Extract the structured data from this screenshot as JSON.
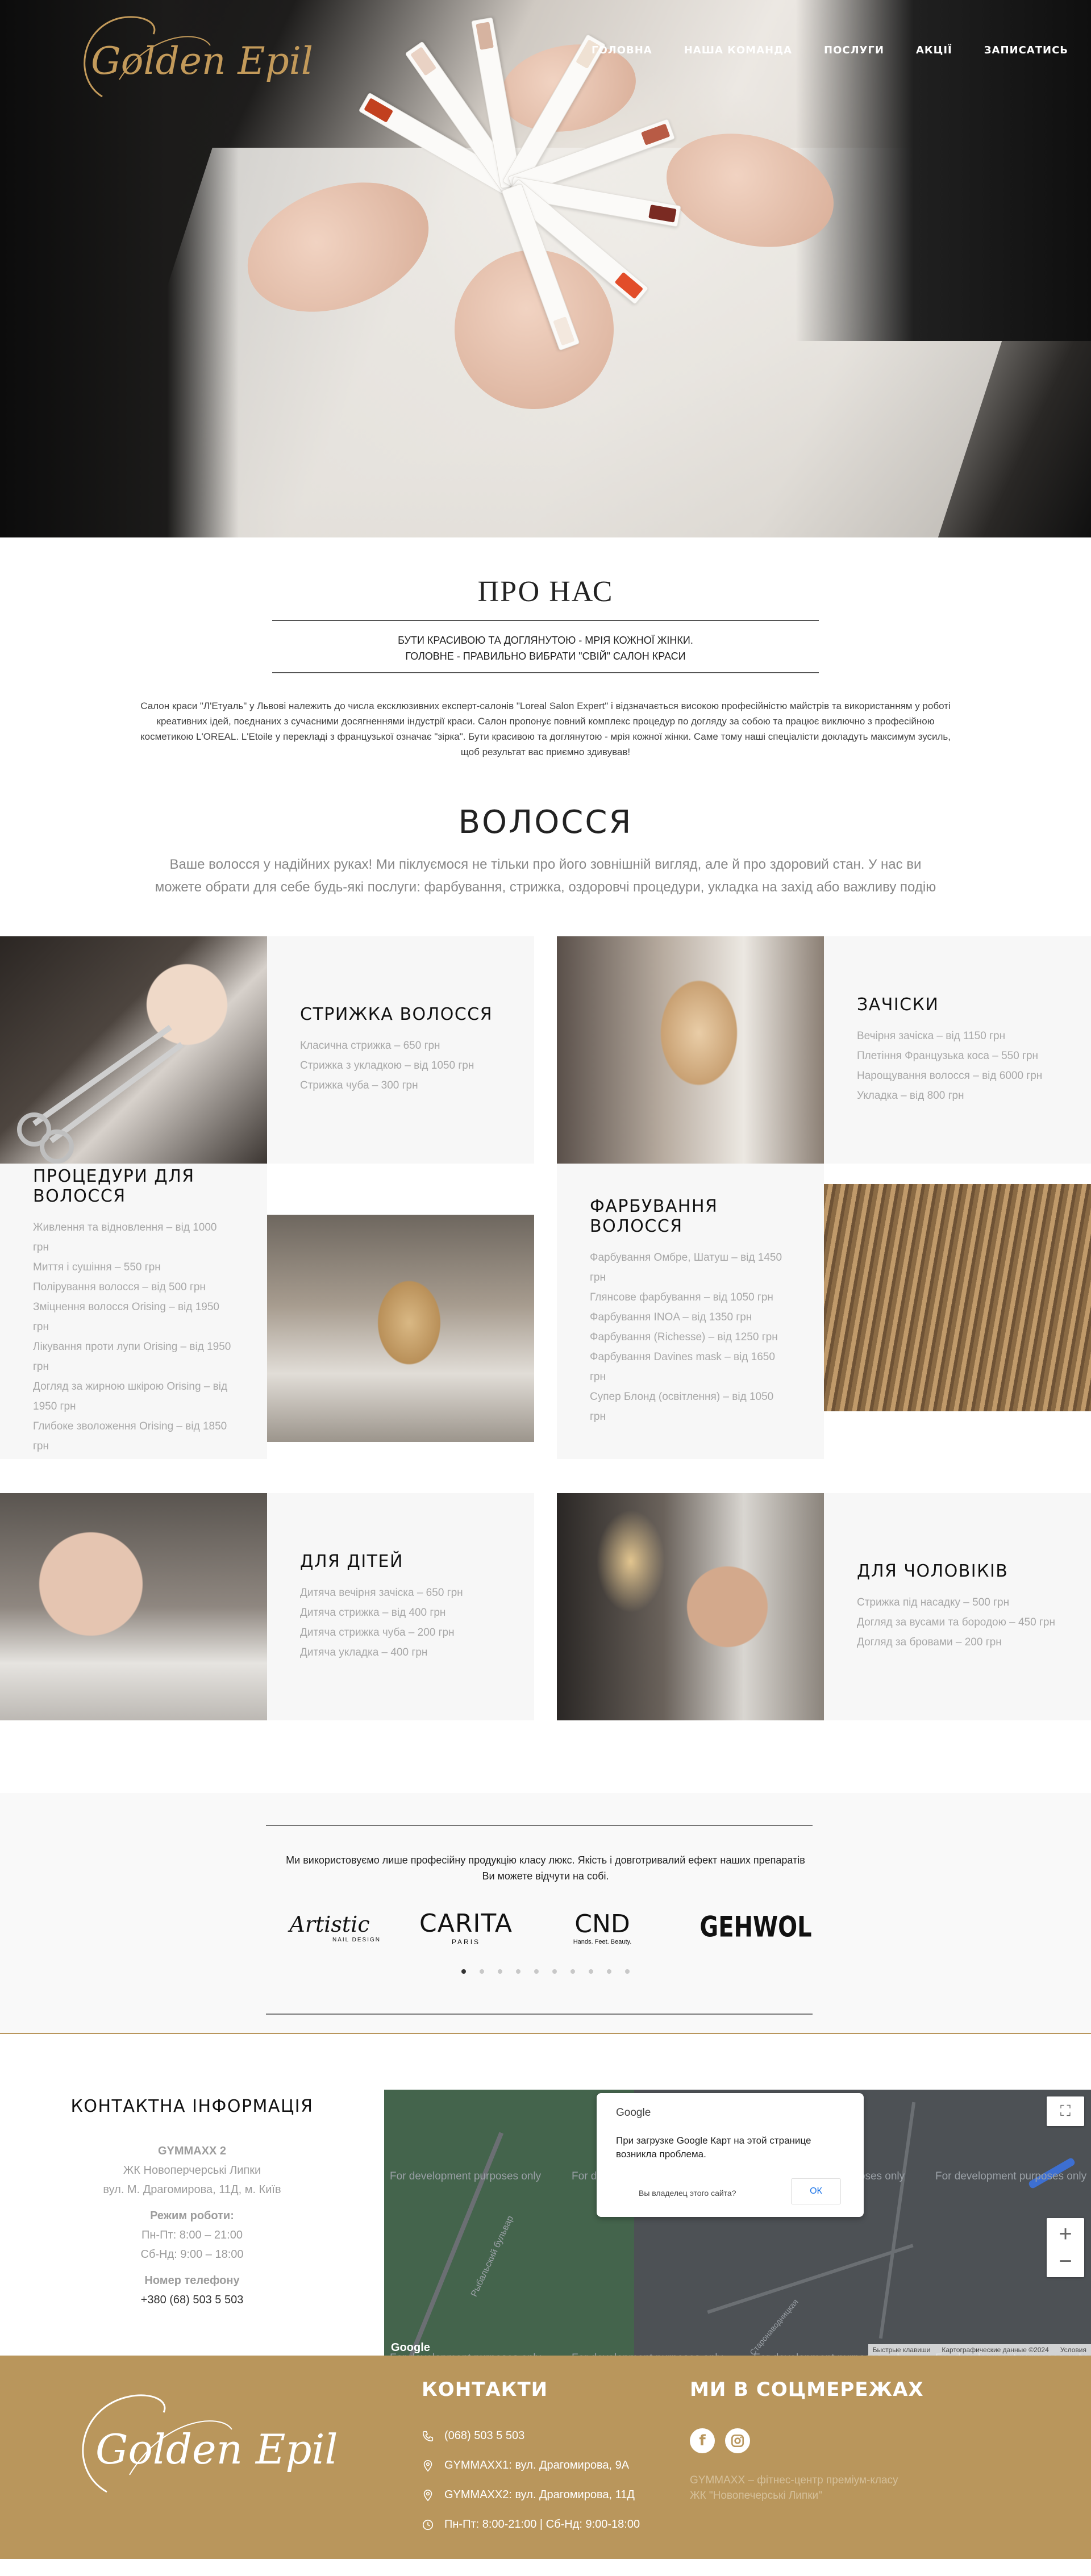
{
  "brand": {
    "logo_text": "Golden Epil",
    "accent": "#b9965c"
  },
  "nav": {
    "items": [
      {
        "label": "ГОЛОВНА"
      },
      {
        "label": "НАША КОМАНДА"
      },
      {
        "label": "ПОСЛУГИ"
      },
      {
        "label": "АКЦІЇ"
      },
      {
        "label": "ЗАПИСАТИСЬ"
      }
    ]
  },
  "about": {
    "title": "ПРО НАС",
    "slogan_1": "БУТИ КРАСИВОЮ ТА ДОГЛЯНУТОЮ - МРІЯ КОЖНОЇ ЖІНКИ.",
    "slogan_2": "ГОЛОВНЕ - ПРАВИЛЬНО ВИБРАТИ \"СВІЙ\" САЛОН КРАСИ",
    "text": "Салон краси \"Л'Етуаль\" у Львові належить до числа ексклюзивних експерт-салонів \"Loreal Salon Expert\" і відзначається високою професійністю майстрів та використанням у роботі креативних ідей, поєднаних з сучасними досягненнями індустрії краси. Салон пропонує повний комплекс процедур по догляду за собою та працює виключно з професійною косметикою L'OREAL. L'Etoile у перекладі з французької означає \"зірка\". Бути красивою та доглянутою - мрія кожної жінки. Саме тому наші спеціалісти докладуть максимум зусиль, щоб результат вас приємно здивував!"
  },
  "hair": {
    "title": "ВОЛОССЯ",
    "subtitle": "Ваше волосся у надійних руках! Ми піклуємося не тільки про його зовнішній вигляд, але й про здоровий стан. У нас ви можете обрати для себе будь-які послуги: фарбування, стрижка, оздоровчі процедури, укладка на захід або важливу подію"
  },
  "services": [
    {
      "title": "СТРИЖКА ВОЛОССЯ",
      "items": [
        "Класична стрижка – 650 грн",
        "Стрижка з укладкою – від 1050 грн",
        "Стрижка чуба – 300 грн"
      ]
    },
    {
      "title": "ЗАЧІСКИ",
      "items": [
        "Вечірня зачіска – від 1150 грн",
        "Плетіння Французька коса – 550 грн",
        "Нарощування волосся – від 6000 грн",
        "Укладка – від 800 грн"
      ]
    },
    {
      "title": "ПРОЦЕДУРИ ДЛЯ ВОЛОССЯ",
      "items": [
        "Живлення та відновлення – від 1000 грн",
        "Миття і сушіння – 550 грн",
        "Полірування волосся – від 500 грн",
        "Зміцнення волосся Orising – від 1950 грн",
        "Лікування проти лупи Orising – від 1950 грн",
        "Догляд за жирною шкірою Orising – від 1950 грн",
        "Глибоке зволоження Orising – від 1850 грн"
      ]
    },
    {
      "title": "ФАРБУВАННЯ ВОЛОССЯ",
      "items": [
        "Фарбування Омбре, Шатуш – від 1450 грн",
        "Глянсове фарбування – від 1050 грн",
        "Фарбування INOA – від 1350 грн",
        "Фарбування (Richesse) – від 1250 грн",
        "Фарбування Davines mask – від 1650 грн",
        "Супер Блонд (освітлення) – від 1050 грн"
      ]
    },
    {
      "title": "ДЛЯ ДІТЕЙ",
      "items": [
        "Дитяча вечірня зачіска – 650 грн",
        "Дитяча стрижка – від 400 грн",
        "Дитяча стрижка чуба – 200 грн",
        "Дитяча укладка – 400 грн"
      ]
    },
    {
      "title": "ДЛЯ ЧОЛОВІКІВ",
      "items": [
        "Стрижка під насадку – 500 грн",
        "Догляд за вусами та бородою – 450 грн",
        "Догляд за бровами – 200 грн"
      ]
    }
  ],
  "brands": {
    "caption_1": "Ми використовуємо лише професійну продукцію класу люкс. Якість і довготривалий ефект наших препаратів",
    "caption_2": "Ви можете відчути на собі.",
    "logos": [
      {
        "name": "Artistic",
        "sub": "NAIL DESIGN"
      },
      {
        "name": "CARITA",
        "sub": "PARIS"
      },
      {
        "name": "CND",
        "sub": "Hands. Feet. Beauty."
      },
      {
        "name": "GEHWOL",
        "sub": ""
      }
    ],
    "dots": 10
  },
  "contact": {
    "title": "КОНТАКТНА ІНФОРМАЦІЯ",
    "name": "GYMMAXX 2",
    "complex": "ЖК Новоперчерські Липки",
    "address": "вул. М. Драгомирова, 11Д, м. Київ",
    "hours_label": "Режим роботи:",
    "hours_1": "Пн-Пт: 8:00 – 21:00",
    "hours_2": "Сб-Нд: 9:00 – 18:00",
    "phone_label": "Номер телефону",
    "phone": "+380 (68) 503 5 503"
  },
  "map": {
    "dev_text": "For development purposes only",
    "dialog_brand": "Google",
    "dialog_message": "При загрузке Google Карт на этой странице возникла проблема.",
    "dialog_question": "Вы владелец этого сайта?",
    "dialog_ok": "ОК",
    "street_1": "Рыбальский бульвар",
    "street_2": "Старонаводницкая",
    "attribution_1": "Быстрые клавиши",
    "attribution_2": "Картографические данные ©2024",
    "attribution_3": "Условия",
    "google_logo": "Google"
  },
  "footer": {
    "contacts_title": "КОНТАКТИ",
    "phone": "(068) 503 5 503",
    "address_1": "GYMMAXX1: вул. Драгомирова, 9А",
    "address_2": "GYMMAXX2: вул. Драгомирова, 11Д",
    "hours": "Пн-Пт: 8:00-21:00 | Сб-Нд: 9:00-18:00",
    "social_title": "МИ В СОЦМЕРЕЖАХ",
    "faint_1": "GYMMAXX – фітнес-центр преміум-класу",
    "faint_2": "ЖК \"Новопечерські Липки\""
  }
}
